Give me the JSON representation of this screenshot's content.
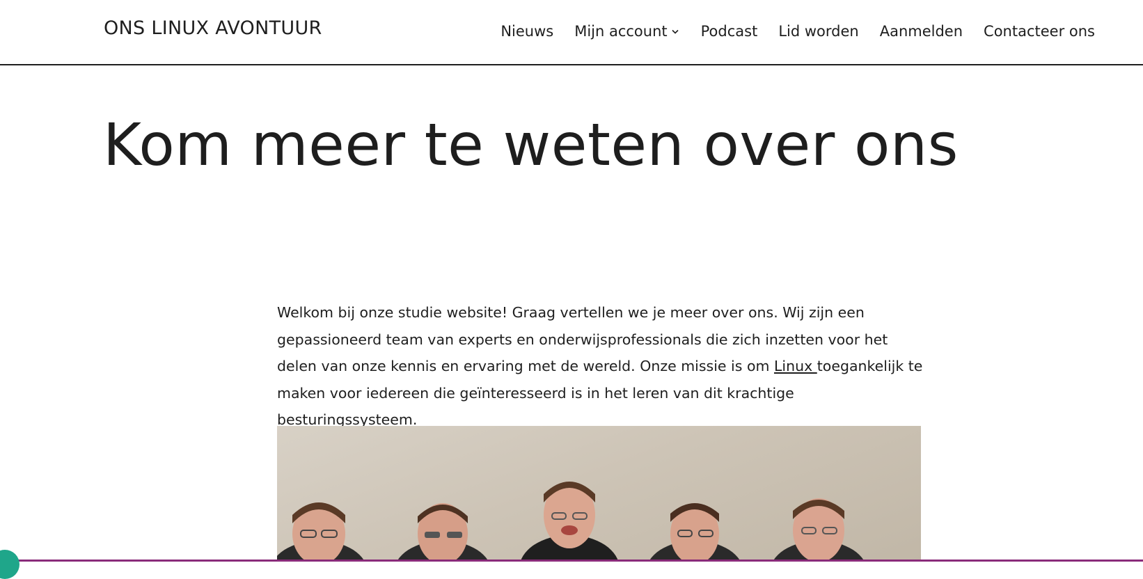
{
  "header": {
    "site_title": "ONS LINUX AVONTUUR",
    "nav": [
      {
        "label": "Nieuws"
      },
      {
        "label": "Mijn account",
        "has_dropdown": true
      },
      {
        "label": "Podcast"
      },
      {
        "label": "Lid worden"
      },
      {
        "label": "Aanmelden"
      },
      {
        "label": "Contacteer ons"
      }
    ]
  },
  "main": {
    "page_title": "Kom meer te weten over ons",
    "intro_before_link": "Welkom bij onze studie website! Graag vertellen we je meer over ons. Wij zijn een gepassioneerd team van experts en onderwijsprofessionals die zich inzetten voor het delen van onze kennis en ervaring met de wereld. Onze missie is om ",
    "intro_link": "Linux ",
    "intro_after_link": "toegankelijk te maken voor iedereen die geïnteresseerd is in het leren van dit krachtige besturingssysteem."
  },
  "colors": {
    "text": "#1e1e1e",
    "background": "#ffffff",
    "bottom_bar": "#8a2b7a",
    "chat_bubble": "#1fa68a"
  },
  "icons": {
    "dropdown": "chevron-down-icon",
    "photo": "team-photo-placeholder"
  }
}
